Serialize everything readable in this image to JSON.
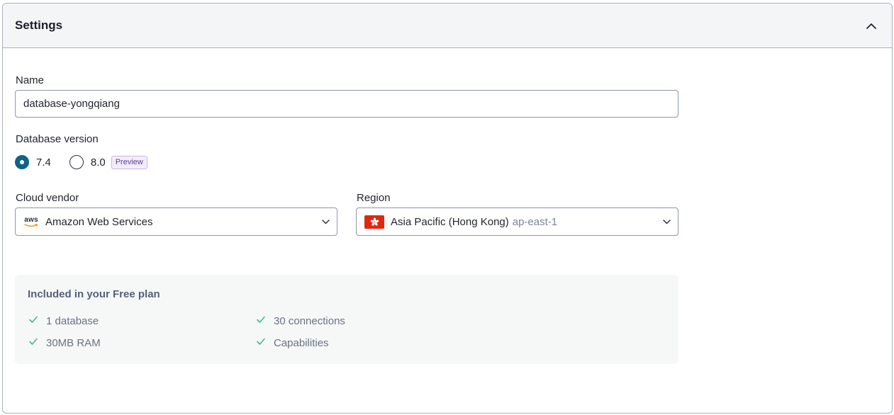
{
  "panel": {
    "title": "Settings",
    "collapse_icon": "chevron-up-icon"
  },
  "name_field": {
    "label": "Name",
    "value": "database-yongqiang"
  },
  "database_version": {
    "label": "Database version",
    "options": [
      {
        "label": "7.4",
        "selected": true
      },
      {
        "label": "8.0",
        "selected": false,
        "badge": "Preview"
      }
    ]
  },
  "cloud_vendor": {
    "label": "Cloud vendor",
    "icon": "aws-logo-icon",
    "icon_text": "aws",
    "selected": "Amazon Web Services"
  },
  "region": {
    "label": "Region",
    "icon": "hong-kong-flag-icon",
    "selected": "Asia Pacific (Hong Kong)",
    "code": "ap-east-1"
  },
  "plan": {
    "title": "Included in your Free plan",
    "items": [
      "1 database",
      "30 connections",
      "30MB RAM",
      "Capabilities"
    ]
  },
  "colors": {
    "accent": "#0e6388",
    "check": "#3fb98b",
    "badge_border": "#c9b6e6",
    "flag_red": "#de2910"
  }
}
